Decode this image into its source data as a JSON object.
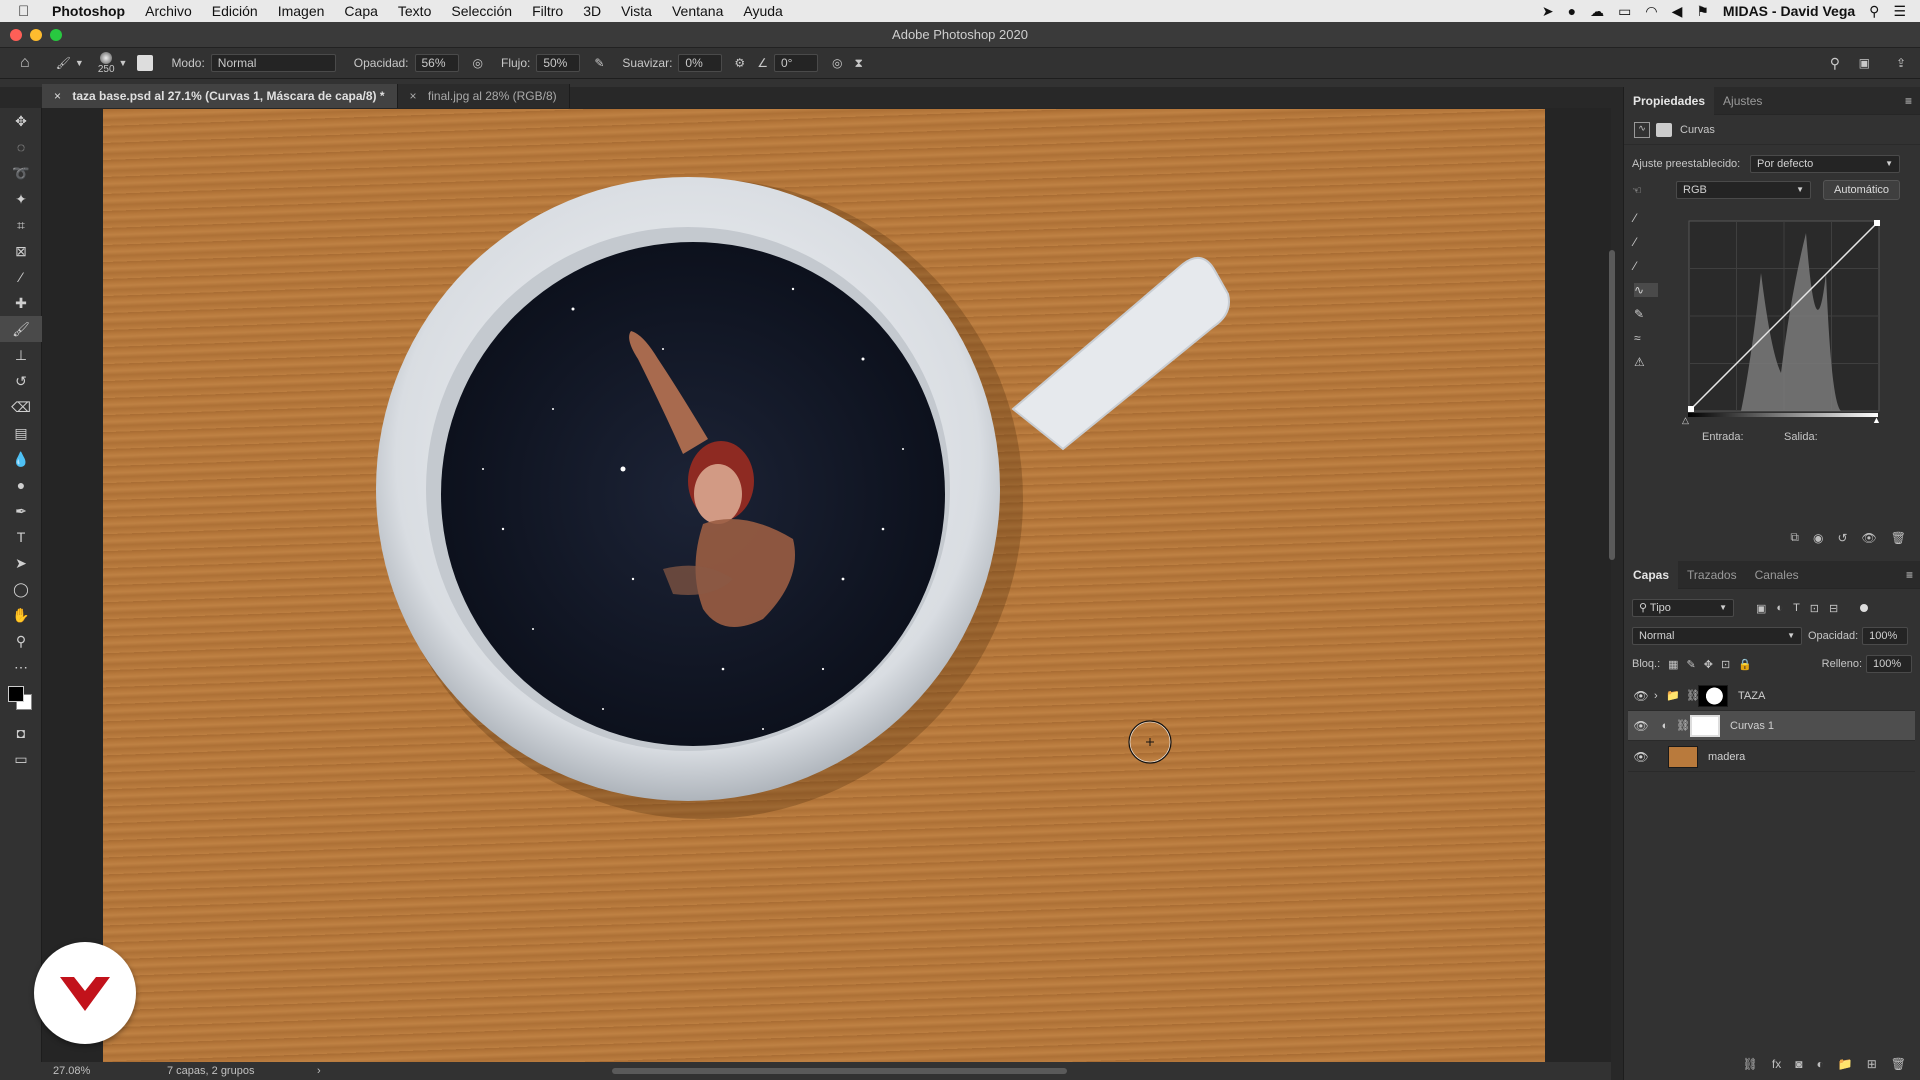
{
  "menubar": {
    "app": "Photoshop",
    "items": [
      "Archivo",
      "Edición",
      "Imagen",
      "Capa",
      "Texto",
      "Selección",
      "Filtro",
      "3D",
      "Vista",
      "Ventana",
      "Ayuda"
    ],
    "user": "MIDAS - David Vega"
  },
  "window": {
    "title": "Adobe Photoshop 2020"
  },
  "options": {
    "brush_size": "250",
    "mode_label": "Modo:",
    "mode_value": "Normal",
    "opacity_label": "Opacidad:",
    "opacity_value": "56%",
    "flow_label": "Flujo:",
    "flow_value": "50%",
    "smooth_label": "Suavizar:",
    "smooth_value": "0%",
    "angle_value": "0°"
  },
  "tabs": [
    {
      "label": "taza base.psd al 27.1% (Curvas 1, Máscara de capa/8) *"
    },
    {
      "label": "final.jpg al 28% (RGB/8)"
    }
  ],
  "status": {
    "zoom": "27.08%",
    "info": "7 capas, 2 grupos"
  },
  "properties": {
    "tabs": [
      "Propiedades",
      "Ajustes"
    ],
    "title": "Curvas",
    "preset_label": "Ajuste preestablecido:",
    "preset_value": "Por defecto",
    "channel": "RGB",
    "auto_button": "Automático",
    "input_label": "Entrada:",
    "output_label": "Salida:"
  },
  "layers_panel": {
    "tabs": [
      "Capas",
      "Trazados",
      "Canales"
    ],
    "filter": "Tipo",
    "blend_mode": "Normal",
    "opacity_label": "Opacidad:",
    "opacity_value": "100%",
    "lock_label": "Bloq.:",
    "fill_label": "Relleno:",
    "fill_value": "100%",
    "layers": [
      {
        "name": "TAZA"
      },
      {
        "name": "Curvas 1"
      },
      {
        "name": "madera"
      }
    ]
  },
  "colors": {
    "wood": "#b97a3c",
    "cup": "#e9ecef",
    "space": "#141a2a",
    "hair": "#9c2a22",
    "logo": "#c2121b"
  }
}
